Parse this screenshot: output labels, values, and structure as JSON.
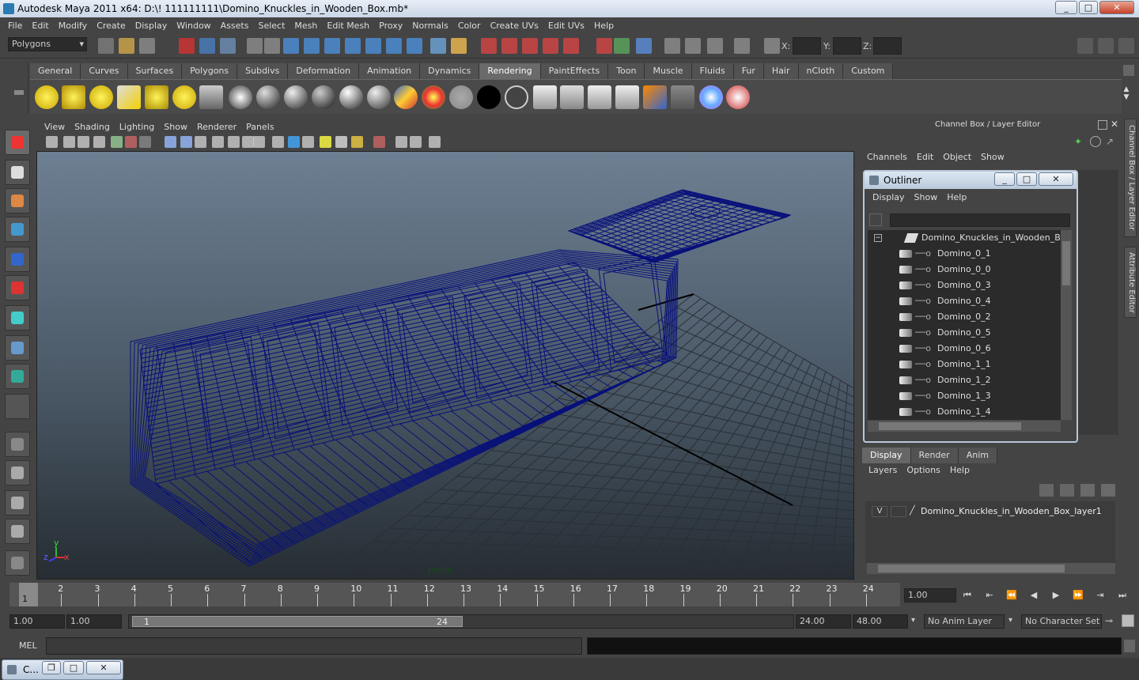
{
  "window": {
    "title": "Autodesk Maya 2011 x64: D:\\! 111111111\\Domino_Knuckles_in_Wooden_Box.mb*",
    "minimize": "_",
    "maximize": "□",
    "close": "✕"
  },
  "menubar": [
    "File",
    "Edit",
    "Modify",
    "Create",
    "Display",
    "Window",
    "Assets",
    "Select",
    "Mesh",
    "Edit Mesh",
    "Proxy",
    "Normals",
    "Color",
    "Create UVs",
    "Edit UVs",
    "Help"
  ],
  "status": {
    "mode": "Polygons",
    "x_label": "X:",
    "y_label": "Y:",
    "z_label": "Z:"
  },
  "shelf": {
    "tabs": [
      "General",
      "Curves",
      "Surfaces",
      "Polygons",
      "Subdivs",
      "Deformation",
      "Animation",
      "Dynamics",
      "Rendering",
      "PaintEffects",
      "Toon",
      "Muscle",
      "Fluids",
      "Fur",
      "Hair",
      "nCloth",
      "Custom"
    ],
    "active_tab": "Rendering"
  },
  "panel": {
    "menu": [
      "View",
      "Shading",
      "Lighting",
      "Show",
      "Renderer",
      "Panels"
    ],
    "camera_label": "persp",
    "axis_x": "x",
    "axis_y": "y",
    "axis_z": "z"
  },
  "channel_box": {
    "title": "Channel Box / Layer Editor",
    "menu": [
      "Channels",
      "Edit",
      "Object",
      "Show"
    ]
  },
  "outliner": {
    "title": "Outliner",
    "menu": [
      "Display",
      "Show",
      "Help"
    ],
    "root": "Domino_Knuckles_in_Wooden_Box",
    "items": [
      "Domino_0_1",
      "Domino_0_0",
      "Domino_0_3",
      "Domino_0_4",
      "Domino_0_2",
      "Domino_0_5",
      "Domino_0_6",
      "Domino_1_1",
      "Domino_1_2",
      "Domino_1_3",
      "Domino_1_4"
    ]
  },
  "layer_editor": {
    "tabs": [
      "Display",
      "Render",
      "Anim"
    ],
    "active_tab": "Display",
    "menu": [
      "Layers",
      "Options",
      "Help"
    ],
    "layer_visibility": "V",
    "layer_name": "Domino_Knuckles_in_Wooden_Box_layer1"
  },
  "side_tabs": {
    "channel_box": "Channel Box / Layer Editor",
    "attribute_editor": "Attribute Editor"
  },
  "timeline": {
    "ticks": [
      "1",
      "2",
      "3",
      "4",
      "5",
      "6",
      "7",
      "8",
      "9",
      "10",
      "11",
      "12",
      "13",
      "14",
      "15",
      "16",
      "17",
      "18",
      "19",
      "20",
      "21",
      "22",
      "23",
      "24"
    ],
    "current_marker": "1",
    "current_time": "1.00"
  },
  "range": {
    "start_time": "1.00",
    "playback_start": "1.00",
    "slider_start": "1",
    "slider_end": "24",
    "playback_end": "24.00",
    "end_time": "48.00",
    "anim_layer": "No Anim Layer",
    "character_set": "No Character Set"
  },
  "command": {
    "label": "MEL"
  },
  "taskbar": {
    "item": "C..."
  }
}
